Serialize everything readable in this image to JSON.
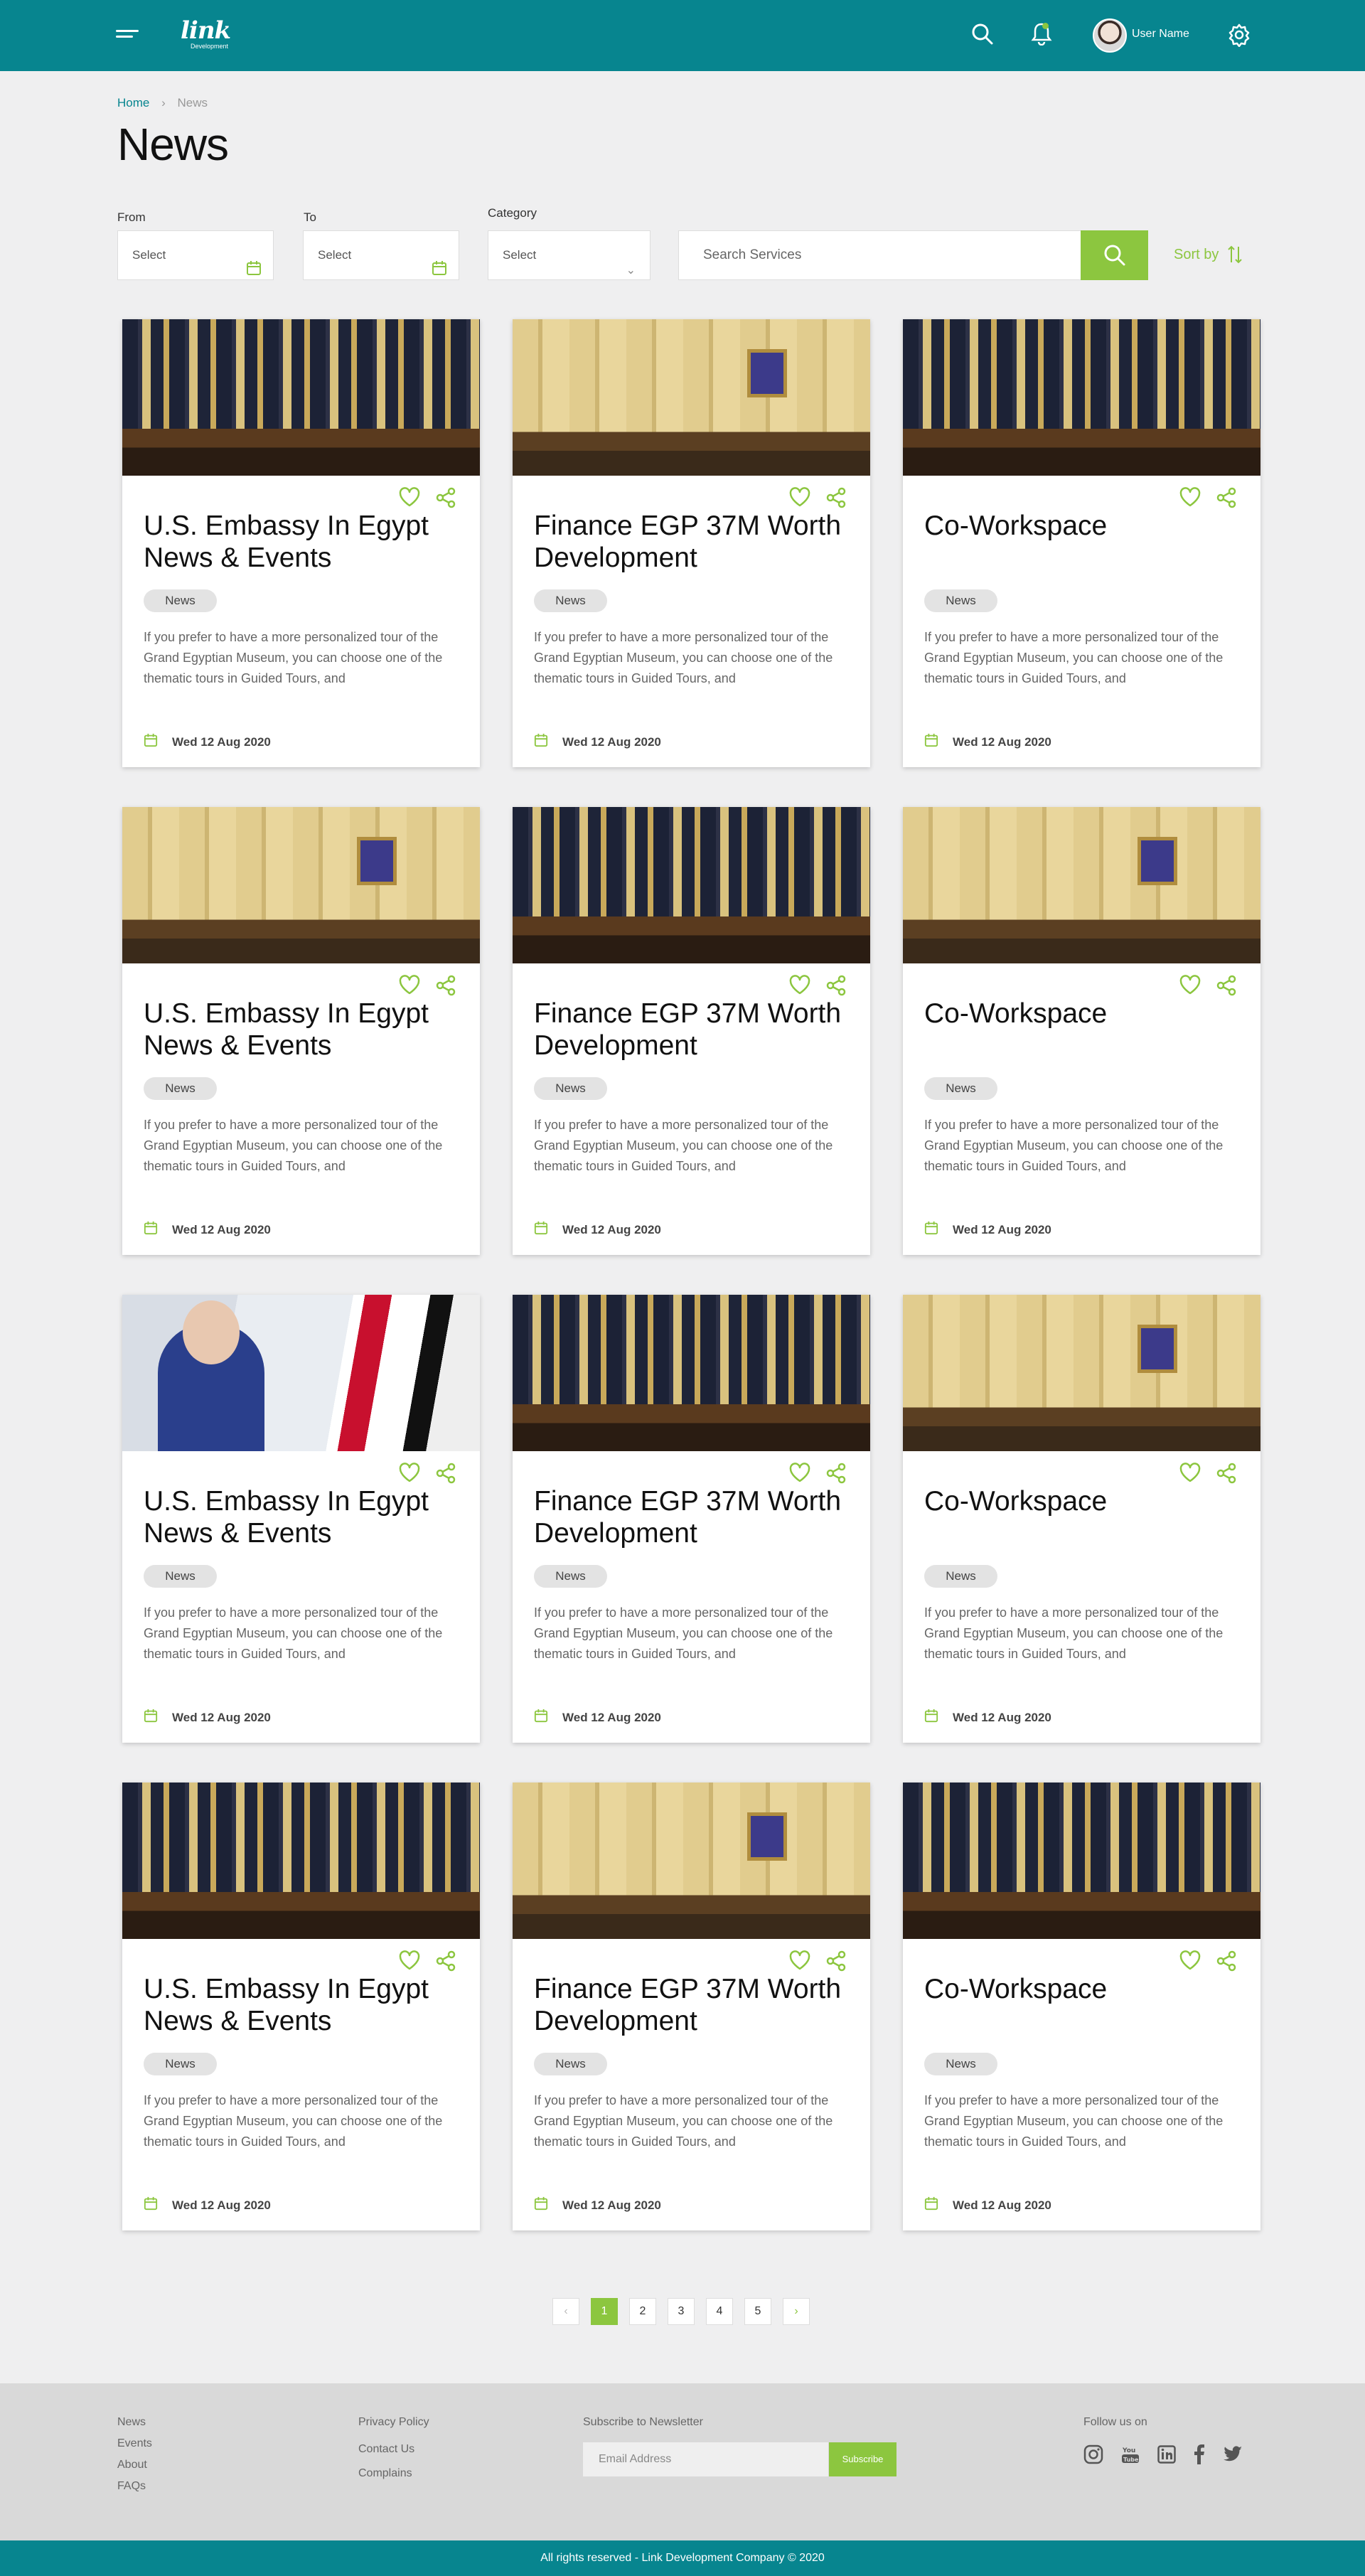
{
  "header": {
    "logo_text": "link",
    "logo_sub": "Development",
    "user_name": "User Name"
  },
  "breadcrumb": {
    "home": "Home",
    "current": "News"
  },
  "page_title": "News",
  "filters": {
    "from_label": "From",
    "to_label": "To",
    "category_label": "Category",
    "from_value": "Select",
    "to_value": "Select",
    "category_value": "Select",
    "search_placeholder": "Search Services",
    "sort_label": "Sort by"
  },
  "cards": [
    {
      "title": "U.S. Embassy In Egypt News & Events",
      "tag": "News",
      "desc": "If you prefer to have a more personalized tour of the Grand Egyptian Museum, you can choose one of the thematic tours in Guided Tours, and",
      "date": "Wed 12 Aug 2020",
      "image": "ceremony"
    },
    {
      "title": "Finance EGP 37M Worth Development",
      "tag": "News",
      "desc": "If you prefer to have a more personalized tour of the Grand Egyptian Museum, you can choose one of the thematic tours in Guided Tours, and",
      "date": "Wed 12 Aug 2020",
      "image": "hall"
    },
    {
      "title": "Co-Workspace",
      "tag": "News",
      "desc": "If you prefer to have a more personalized tour of the Grand Egyptian Museum, you can choose one of the thematic tours in Guided Tours, and",
      "date": "Wed 12 Aug 2020",
      "image": "ceremony"
    },
    {
      "title": "U.S. Embassy In Egypt News & Events",
      "tag": "News",
      "desc": "If you prefer to have a more personalized tour of the Grand Egyptian Museum, you can choose one of the thematic tours in Guided Tours, and",
      "date": "Wed 12 Aug 2020",
      "image": "hall"
    },
    {
      "title": "Finance EGP 37M Worth Development",
      "tag": "News",
      "desc": "If you prefer to have a more personalized tour of the Grand Egyptian Museum, you can choose one of the thematic tours in Guided Tours, and",
      "date": "Wed 12 Aug 2020",
      "image": "ceremony"
    },
    {
      "title": "Co-Workspace",
      "tag": "News",
      "desc": "If you prefer to have a more personalized tour of the Grand Egyptian Museum, you can choose one of the thematic tours in Guided Tours, and",
      "date": "Wed 12 Aug 2020",
      "image": "hall"
    },
    {
      "title": "U.S. Embassy In Egypt News & Events",
      "tag": "News",
      "desc": "If you prefer to have a more personalized tour of the Grand Egyptian Museum, you can choose one of the thematic tours in Guided Tours, and",
      "date": "Wed 12 Aug 2020",
      "image": "portrait"
    },
    {
      "title": "Finance EGP 37M Worth Development",
      "tag": "News",
      "desc": "If you prefer to have a more personalized tour of the Grand Egyptian Museum, you can choose one of the thematic tours in Guided Tours, and",
      "date": "Wed 12 Aug 2020",
      "image": "ceremony"
    },
    {
      "title": "Co-Workspace",
      "tag": "News",
      "desc": "If you prefer to have a more personalized tour of the Grand Egyptian Museum, you can choose one of the thematic tours in Guided Tours, and",
      "date": "Wed 12 Aug 2020",
      "image": "hall"
    },
    {
      "title": "U.S. Embassy In Egypt News & Events",
      "tag": "News",
      "desc": "If you prefer to have a more personalized tour of the Grand Egyptian Museum, you can choose one of the thematic tours in Guided Tours, and",
      "date": "Wed 12 Aug 2020",
      "image": "ceremony"
    },
    {
      "title": "Finance EGP 37M Worth Development",
      "tag": "News",
      "desc": "If you prefer to have a more personalized tour of the Grand Egyptian Museum, you can choose one of the thematic tours in Guided Tours, and",
      "date": "Wed 12 Aug 2020",
      "image": "hall"
    },
    {
      "title": "Co-Workspace",
      "tag": "News",
      "desc": "If you prefer to have a more personalized tour of the Grand Egyptian Museum, you can choose one of the thematic tours in Guided Tours, and",
      "date": "Wed 12 Aug 2020",
      "image": "ceremony"
    }
  ],
  "pagination": {
    "pages": [
      "1",
      "2",
      "3",
      "4",
      "5"
    ],
    "active": "1",
    "prev": "‹",
    "next": "›"
  },
  "footer": {
    "col1": [
      "News",
      "Events",
      "About",
      "FAQs"
    ],
    "col2": [
      "Privacy Policy",
      "Contact Us",
      "Complains"
    ],
    "newsletter_title": "Subscribe to Newsletter",
    "email_placeholder": "Email Address",
    "subscribe_label": "Subscribe",
    "follow_title": "Follow us on",
    "social_icons": [
      "instagram-icon",
      "youtube-icon",
      "linkedin-icon",
      "facebook-icon",
      "twitter-icon"
    ],
    "copyright": "All rights reserved - Link Development Company © 2020"
  },
  "colors": {
    "primary": "#07858f",
    "accent": "#8cc63f",
    "background": "#efeff0"
  }
}
